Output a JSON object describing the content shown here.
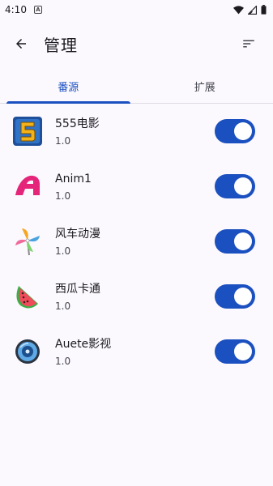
{
  "status_bar": {
    "time": "4:10",
    "notif_glyph": "A"
  },
  "app_bar": {
    "title": "管理",
    "back_icon": "arrow-back-icon",
    "sort_icon": "sort-icon"
  },
  "tabs": [
    {
      "label": "番源",
      "active": true
    },
    {
      "label": "扩展",
      "active": false
    }
  ],
  "sources": [
    {
      "name": "555电影",
      "version": "1.0",
      "enabled": true,
      "icon": "555-logo-icon"
    },
    {
      "name": "Anim1",
      "version": "1.0",
      "enabled": true,
      "icon": "anim1-logo-icon"
    },
    {
      "name": "风车动漫",
      "version": "1.0",
      "enabled": true,
      "icon": "pinwheel-logo-icon"
    },
    {
      "name": "西瓜卡通",
      "version": "1.0",
      "enabled": true,
      "icon": "watermelon-logo-icon"
    },
    {
      "name": "Auete影视",
      "version": "1.0",
      "enabled": true,
      "icon": "auete-logo-icon"
    }
  ],
  "colors": {
    "accent": "#1b50c0",
    "background": "#fbf8fe"
  }
}
